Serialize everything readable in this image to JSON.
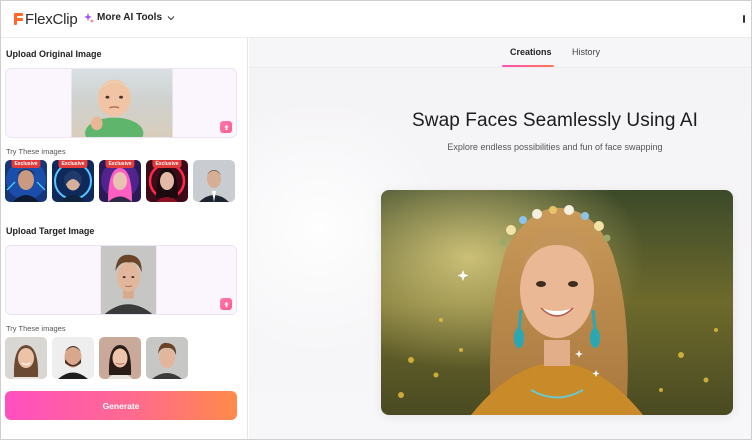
{
  "header": {
    "logo_text": "FlexClip",
    "more_tools_label": "More AI Tools"
  },
  "left_panel": {
    "original": {
      "title": "Upload Original Image",
      "try_label": "Try These images",
      "samples": [
        {
          "badge": "Exclusive",
          "name": "sample-cyber-man"
        },
        {
          "badge": "Exclusive",
          "name": "sample-cyber-woman-blue"
        },
        {
          "badge": "Exclusive",
          "name": "sample-pink-hair"
        },
        {
          "badge": "Exclusive",
          "name": "sample-red-woman"
        },
        {
          "badge": "",
          "name": "sample-suit-man"
        }
      ]
    },
    "target": {
      "title": "Upload Target Image",
      "try_label": "Try These images",
      "samples": [
        {
          "name": "sample-woman-smile"
        },
        {
          "name": "sample-man-beard"
        },
        {
          "name": "sample-asian-woman"
        },
        {
          "name": "sample-young-man"
        }
      ]
    },
    "generate_label": "Generate"
  },
  "right_panel": {
    "tabs": [
      {
        "label": "Creations",
        "active": true
      },
      {
        "label": "History",
        "active": false
      }
    ],
    "hero_title": "Swap Faces Seamlessly Using AI",
    "hero_subtitle": "Explore endless possibilities and fun of face swapping"
  },
  "colors": {
    "accent_start": "#ff4fc0",
    "accent_end": "#ff8a4a",
    "badge_red": "#e23a3a",
    "logo_orange": "#ff6a2b"
  }
}
